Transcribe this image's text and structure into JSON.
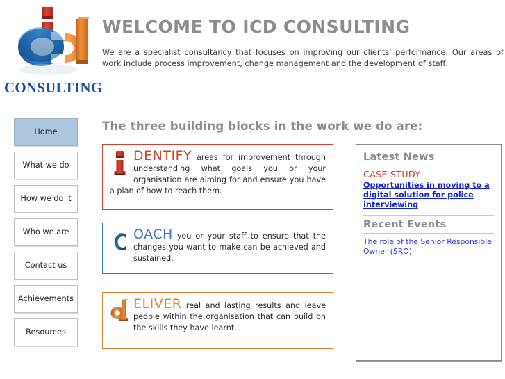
{
  "header": {
    "logo": {
      "mark_name": "icd-logo-mark",
      "wordmark": "CONSULTING",
      "colors": {
        "blue": "#1a66b3",
        "red": "#cc3326",
        "orange": "#e8822a",
        "wordmark_blue": "#1a4f9c"
      }
    },
    "title": "WELCOME TO ICD CONSULTING",
    "intro": "We are a specialist consultancy that focuses on improving our clients' performance. Our areas of work include process improvement, change management and the development of staff."
  },
  "nav": {
    "items": [
      {
        "label": "Home",
        "active": true
      },
      {
        "label": "What we do",
        "active": false
      },
      {
        "label": "How we do it",
        "active": false
      },
      {
        "label": "Who we are",
        "active": false
      },
      {
        "label": "Contact us",
        "active": false
      },
      {
        "label": "Achievements",
        "active": false
      },
      {
        "label": "Resources",
        "active": false
      }
    ],
    "active_bg": "#adc6de"
  },
  "main": {
    "heading": "The three building blocks in the work we do are:",
    "cards": [
      {
        "icon": "letter-i-3d-icon",
        "lead": "DENTIFY",
        "accent": "#d4402e",
        "body": " areas for improvement through understanding what goals you or your organisation are aiming for and ensure you have a plan of how to reach them."
      },
      {
        "icon": "letter-c-3d-icon",
        "lead": "OACH",
        "accent": "#3a78c2",
        "body": " you or your staff to ensure that the changes you want to make can be achieved and sustained."
      },
      {
        "icon": "letter-d-3d-icon",
        "lead": "ELIVER",
        "accent": "#e8822a",
        "body": " real and lasting results and leave people within the organisation that can build on the skills they have learnt."
      }
    ]
  },
  "panel": {
    "news_heading": "Latest News",
    "case_study_label": "CASE STUDY",
    "case_study_link": "Opportunities in moving to a digital solution for police interviewing",
    "events_heading": "Recent Events",
    "event_link": "The role of the Senior Responsible Owner (SRO)",
    "link_color": "#1122dd"
  }
}
